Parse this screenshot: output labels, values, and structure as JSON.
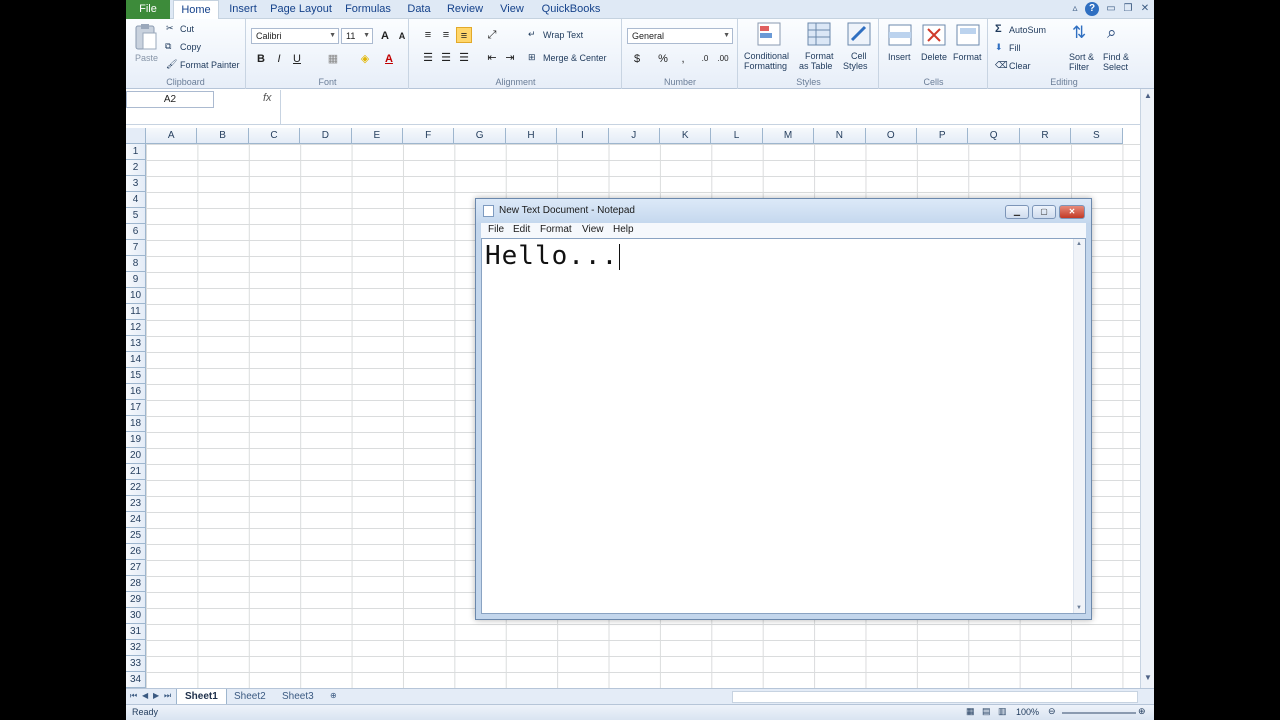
{
  "excel": {
    "tabs": {
      "file": "File",
      "home": "Home",
      "insert": "Insert",
      "page_layout": "Page Layout",
      "formulas": "Formulas",
      "data": "Data",
      "review": "Review",
      "view": "View",
      "quickbooks": "QuickBooks"
    },
    "ribbon": {
      "clipboard": {
        "paste": "Paste",
        "cut": "Cut",
        "copy": "Copy",
        "format_painter": "Format Painter",
        "label": "Clipboard"
      },
      "font": {
        "name": "Calibri",
        "size": "11",
        "bold": "B",
        "italic": "I",
        "underline": "U",
        "label": "Font"
      },
      "alignment": {
        "wrap_text": "Wrap Text",
        "merge_center": "Merge & Center",
        "label": "Alignment"
      },
      "number": {
        "format": "General",
        "currency": "$",
        "percent": "%",
        "comma": ",",
        "label": "Number"
      },
      "styles": {
        "conditional_1": "Conditional",
        "conditional_2": "Formatting",
        "format_table_1": "Format",
        "format_table_2": "as Table",
        "cell_styles_1": "Cell",
        "cell_styles_2": "Styles",
        "label": "Styles"
      },
      "cells": {
        "insert": "Insert",
        "delete": "Delete",
        "format": "Format",
        "label": "Cells"
      },
      "editing": {
        "autosum": "AutoSum",
        "fill": "Fill",
        "clear": "Clear",
        "sort_1": "Sort &",
        "sort_2": "Filter",
        "find_1": "Find &",
        "find_2": "Select",
        "label": "Editing"
      }
    },
    "name_box": "A2",
    "fx": "fx",
    "columns": [
      "A",
      "B",
      "C",
      "D",
      "E",
      "F",
      "G",
      "H",
      "I",
      "J",
      "K",
      "L",
      "M",
      "N",
      "O",
      "P",
      "Q",
      "R",
      "S"
    ],
    "rows": [
      "1",
      "2",
      "3",
      "4",
      "5",
      "6",
      "7",
      "8",
      "9",
      "10",
      "11",
      "12",
      "13",
      "14",
      "15",
      "16",
      "17",
      "18",
      "19",
      "20",
      "21",
      "22",
      "23",
      "24",
      "25",
      "26",
      "27",
      "28",
      "29",
      "30",
      "31",
      "32",
      "33",
      "34"
    ],
    "sheets": [
      "Sheet1",
      "Sheet2",
      "Sheet3"
    ],
    "status": "Ready",
    "zoom": "100%"
  },
  "notepad": {
    "title": "New Text Document - Notepad",
    "menu": {
      "file": "File",
      "edit": "Edit",
      "format": "Format",
      "view": "View",
      "help": "Help"
    },
    "content": "Hello..."
  }
}
